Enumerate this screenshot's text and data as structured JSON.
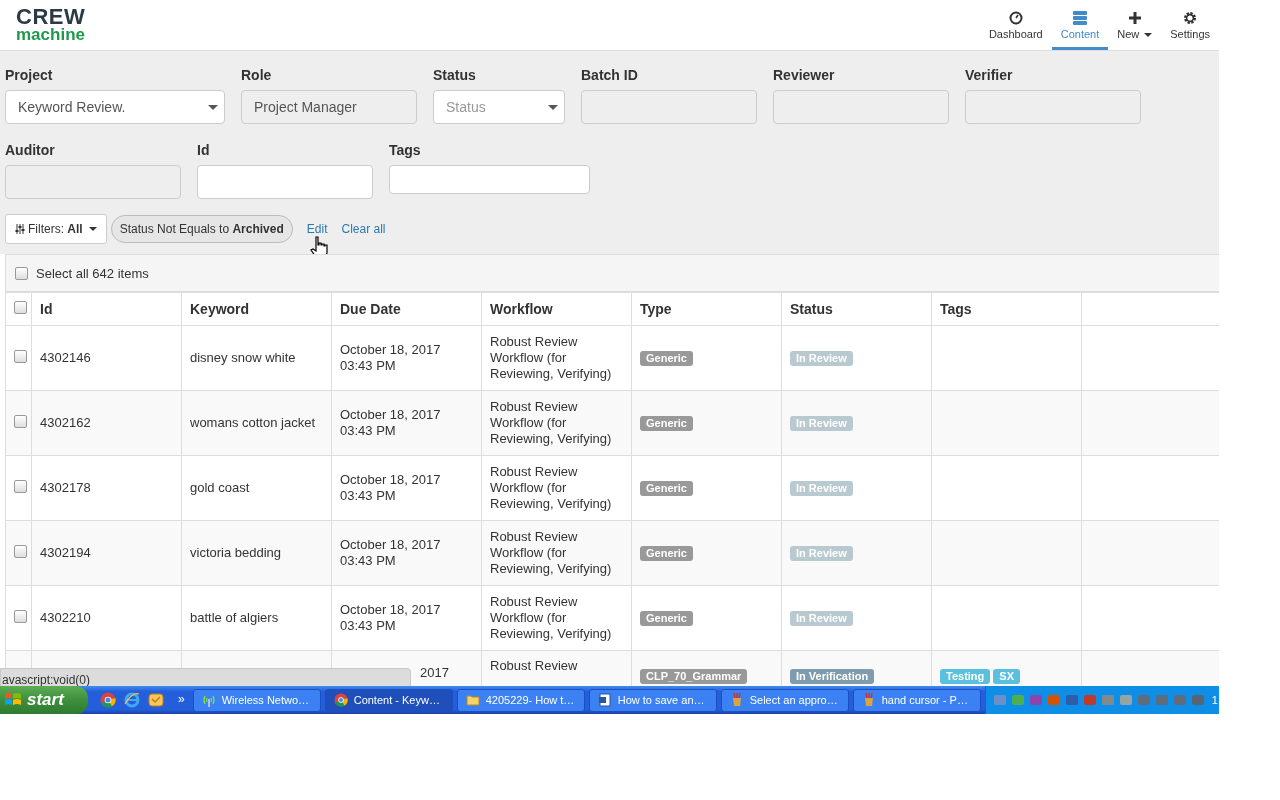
{
  "header": {
    "logo_top": "CREW",
    "logo_bottom": "machine",
    "nav": [
      {
        "label": "Dashboard",
        "selected": false,
        "caret": false
      },
      {
        "label": "Content",
        "selected": true,
        "caret": false
      },
      {
        "label": "New",
        "selected": false,
        "caret": true
      },
      {
        "label": "Settings",
        "selected": false,
        "caret": false
      }
    ]
  },
  "filters": {
    "fields": [
      {
        "label": "Project",
        "kind": "select",
        "value": "Keyword Review."
      },
      {
        "label": "Role",
        "kind": "disabled",
        "value": "Project Manager"
      },
      {
        "label": "Status",
        "kind": "select",
        "placeholder": "Status"
      },
      {
        "label": "Batch ID",
        "kind": "disabled"
      },
      {
        "label": "Reviewer",
        "kind": "disabled"
      },
      {
        "label": "Verifier",
        "kind": "disabled"
      },
      {
        "label": "Auditor",
        "kind": "disabled"
      },
      {
        "label": "Id",
        "kind": "input"
      },
      {
        "label": "Tags",
        "kind": "input"
      }
    ],
    "filters_button": "Filters: **All**",
    "chips": [
      "Status Not Equals to **Archived**"
    ],
    "links": [
      "Edit",
      "Clear all"
    ]
  },
  "table": {
    "select_all": {
      "label": "Select all 642 items",
      "checked": false
    },
    "header_checkbox": {
      "checked": false
    },
    "columns": [
      "Id",
      "Keyword",
      "Due Date",
      "Workflow",
      "Type",
      "Status",
      "Tags"
    ],
    "rows": [
      {
        "checked": false,
        "id": "4302146",
        "keyword": "disney snow white",
        "due": [
          "October 18, 2017",
          "03:43 PM"
        ],
        "workflow": "Robust Review Workflow (for Reviewing, Verifying)",
        "type": [
          {
            "text": "Generic",
            "color": "#999999"
          }
        ],
        "status": [
          {
            "text": "In Review",
            "color": "#b9c9d0"
          }
        ],
        "tags": []
      },
      {
        "checked": false,
        "id": "4302162",
        "keyword": "womans cotton jacket",
        "due": [
          "October 18, 2017",
          "03:43 PM"
        ],
        "workflow": "Robust Review Workflow (for Reviewing, Verifying)",
        "type": [
          {
            "text": "Generic",
            "color": "#999999"
          }
        ],
        "status": [
          {
            "text": "In Review",
            "color": "#b9c9d0"
          }
        ],
        "tags": []
      },
      {
        "checked": false,
        "id": "4302178",
        "keyword": "gold coast",
        "due": [
          "October 18, 2017",
          "03:43 PM"
        ],
        "workflow": "Robust Review Workflow (for Reviewing, Verifying)",
        "type": [
          {
            "text": "Generic",
            "color": "#999999"
          }
        ],
        "status": [
          {
            "text": "In Review",
            "color": "#b9c9d0"
          }
        ],
        "tags": []
      },
      {
        "checked": false,
        "id": "4302194",
        "keyword": "victoria bedding",
        "due": [
          "October 18, 2017",
          "03:43 PM"
        ],
        "workflow": "Robust Review Workflow (for Reviewing, Verifying)",
        "type": [
          {
            "text": "Generic",
            "color": "#999999"
          }
        ],
        "status": [
          {
            "text": "In Review",
            "color": "#b9c9d0"
          }
        ],
        "tags": []
      },
      {
        "checked": false,
        "id": "4302210",
        "keyword": "battle of algiers",
        "due": [
          "October 18, 2017",
          "03:43 PM"
        ],
        "workflow": "Robust Review Workflow (for Reviewing, Verifying)",
        "type": [
          {
            "text": "Generic",
            "color": "#999999"
          }
        ],
        "status": [
          {
            "text": "In Review",
            "color": "#b9c9d0"
          }
        ],
        "tags": []
      },
      {
        "due": [
          "2017"
        ],
        "workflow": "Robust Review",
        "type": [
          {
            "text": "CLP_70_Grammar",
            "color": "#999999"
          }
        ],
        "status": [
          {
            "text": "In Verification",
            "color": "#7f9cae"
          }
        ],
        "tags": [
          {
            "text": "Testing",
            "color": "#5bc0de"
          },
          {
            "text": "SX",
            "color": "#5bc0de"
          }
        ]
      }
    ]
  },
  "status_url": "avascript:void(0)",
  "taskbar": {
    "start": "start",
    "more": "»",
    "tasks": [
      {
        "label": "Wireless Netwo…",
        "selected": false
      },
      {
        "label": "Content - Keyw…",
        "selected": true
      },
      {
        "label": "4205229- How t…",
        "selected": false
      },
      {
        "label": "How to save an…",
        "selected": false
      },
      {
        "label": "Select an appro…",
        "selected": false
      },
      {
        "label": "hand cursor - P…",
        "selected": false
      }
    ],
    "clock": "1"
  }
}
